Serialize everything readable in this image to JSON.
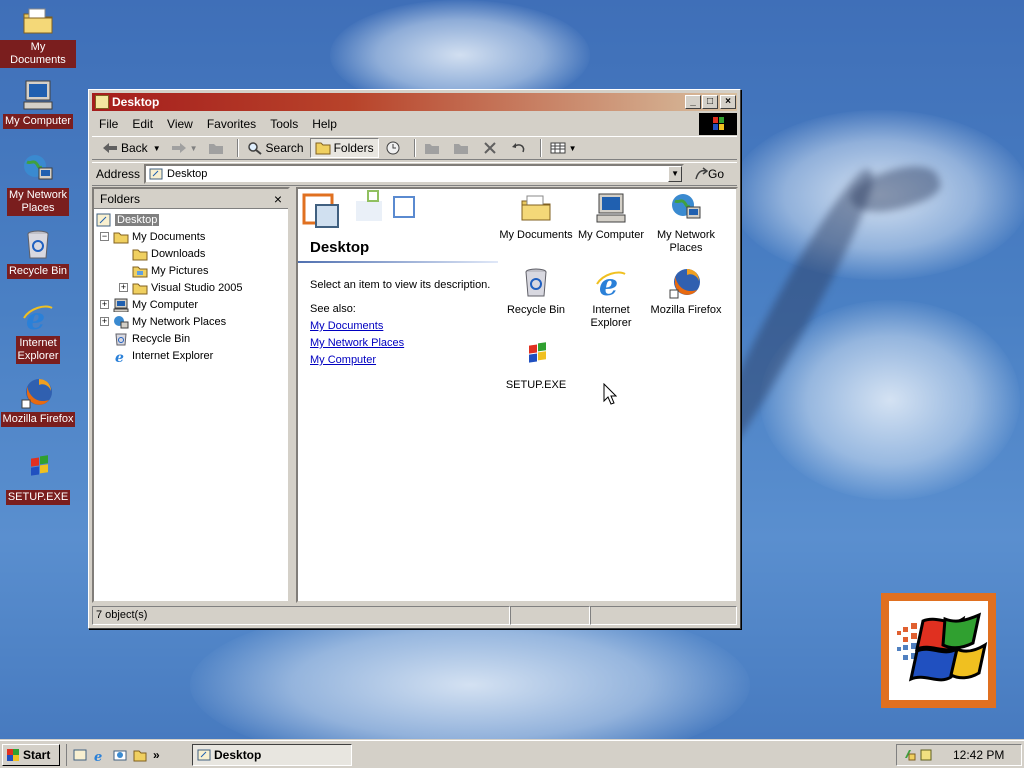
{
  "desktop": {
    "icons": [
      {
        "label": "My Documents",
        "icon": "my-documents-icon"
      },
      {
        "label": "My Computer",
        "icon": "my-computer-icon"
      },
      {
        "label_line1": "My Network",
        "label_line2": "Places",
        "icon": "network-places-icon"
      },
      {
        "label": "Recycle Bin",
        "icon": "recycle-bin-icon"
      },
      {
        "label_line1": "Internet",
        "label_line2": "Explorer",
        "icon": "internet-explorer-icon"
      },
      {
        "label": "Mozilla Firefox",
        "icon": "firefox-icon"
      },
      {
        "label": "SETUP.EXE",
        "icon": "setup-exe-icon"
      }
    ]
  },
  "window": {
    "title": "Desktop",
    "menu": [
      "File",
      "Edit",
      "View",
      "Favorites",
      "Tools",
      "Help"
    ],
    "toolbar": {
      "back": "Back",
      "search": "Search",
      "folders": "Folders"
    },
    "address": {
      "label": "Address",
      "value": "Desktop",
      "go": "Go"
    },
    "folders_pane": {
      "title": "Folders",
      "close": "×",
      "tree": [
        {
          "label": "Desktop",
          "expander": "",
          "selected": true
        },
        {
          "label": "My Documents",
          "expander": "−"
        },
        {
          "label": "Downloads",
          "expander": ""
        },
        {
          "label": "My Pictures",
          "expander": ""
        },
        {
          "label": "Visual Studio 2005",
          "expander": "+"
        },
        {
          "label": "My Computer",
          "expander": "+"
        },
        {
          "label": "My Network Places",
          "expander": "+"
        },
        {
          "label": "Recycle Bin",
          "expander": ""
        },
        {
          "label": "Internet Explorer",
          "expander": ""
        }
      ]
    },
    "content": {
      "title": "Desktop",
      "description": "Select an item to view its description.",
      "see_also": "See also:",
      "links": [
        "My Documents",
        "My Network Places",
        "My Computer"
      ],
      "items": [
        {
          "label": "My Documents"
        },
        {
          "label": "My Computer"
        },
        {
          "label_line1": "My Network",
          "label_line2": "Places"
        },
        {
          "label": "Recycle Bin"
        },
        {
          "label_line1": "Internet",
          "label_line2": "Explorer"
        },
        {
          "label": "Mozilla Firefox"
        },
        {
          "label": "SETUP.EXE"
        }
      ]
    },
    "status": {
      "objects": "7 object(s)"
    }
  },
  "taskbar": {
    "start": "Start",
    "chevron": "»",
    "task": "Desktop",
    "clock": "12:42 PM"
  },
  "colors": {
    "title_active": "#a51d1d",
    "desktop_bg": "#4a80c4",
    "label_bg": "#7a1e1e",
    "link": "#0000c0"
  }
}
